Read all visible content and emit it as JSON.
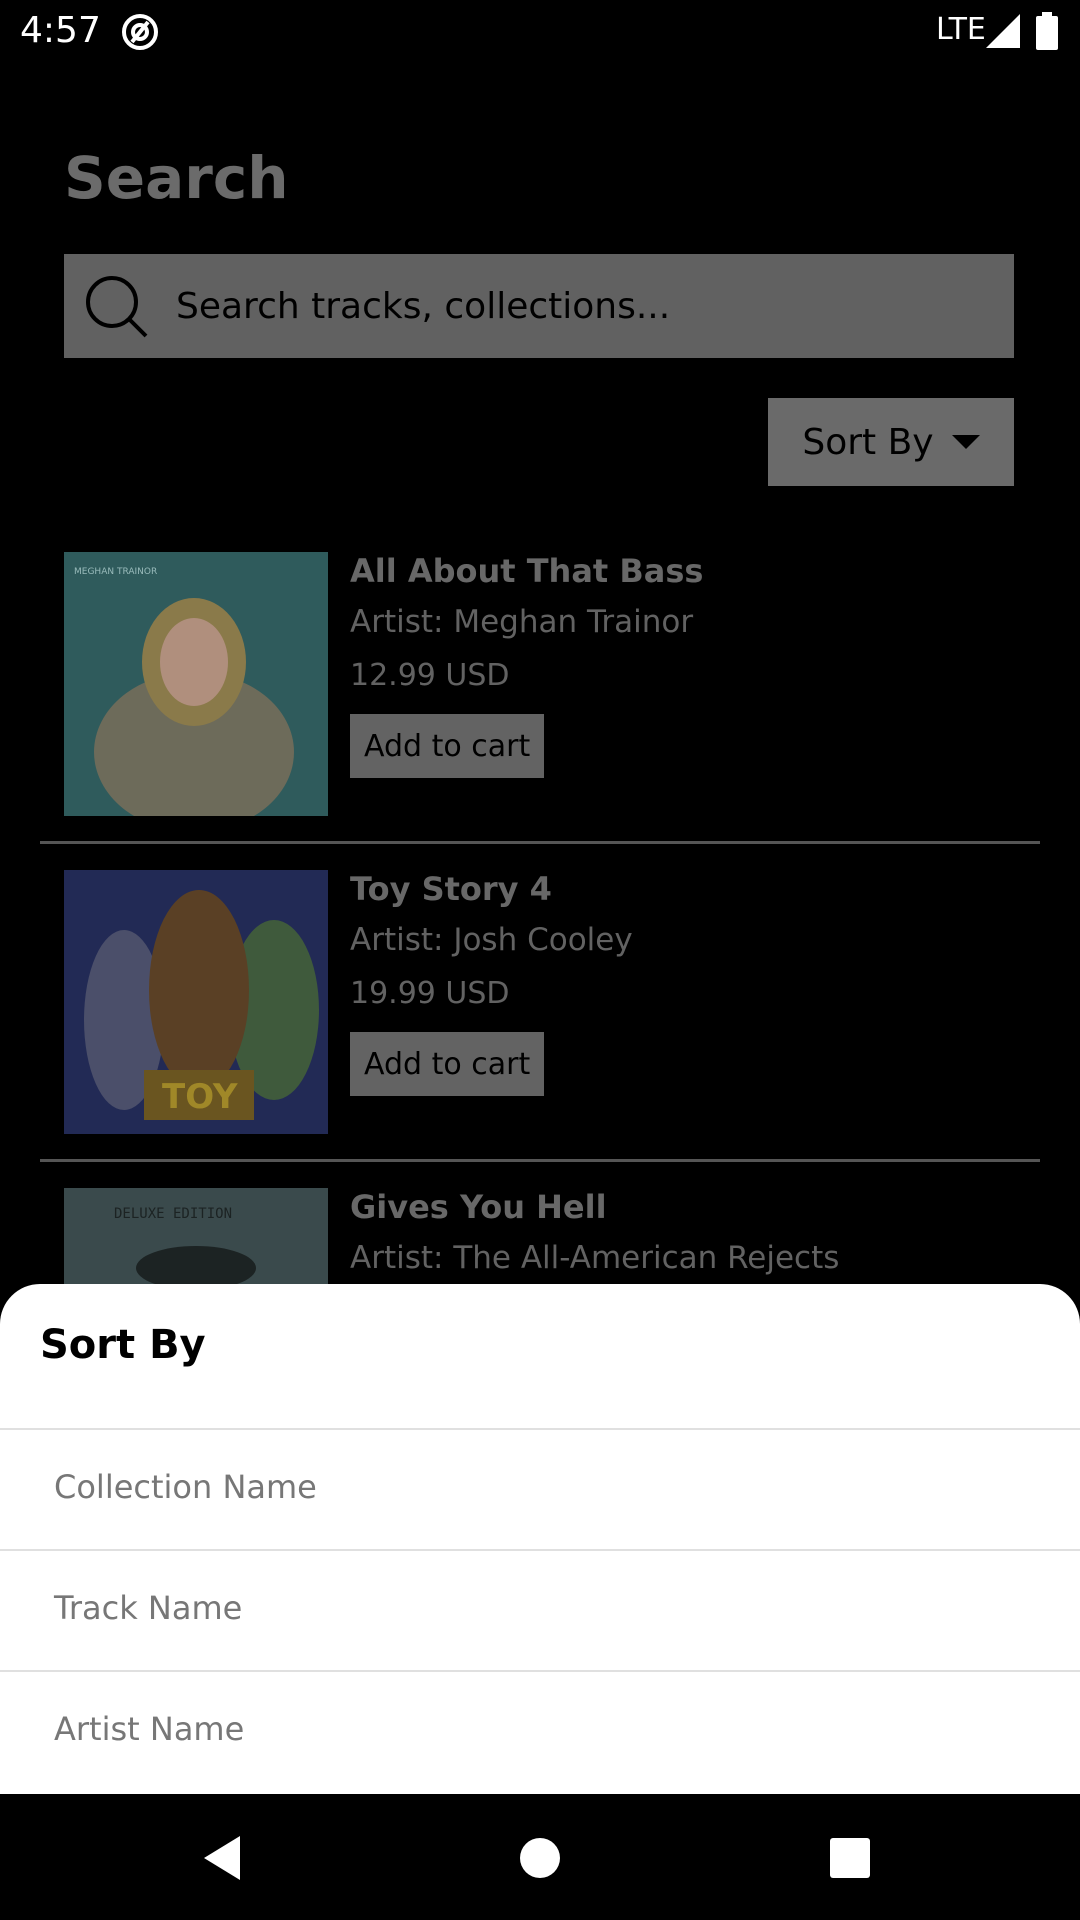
{
  "status_bar": {
    "time": "4:57",
    "network": "LTE"
  },
  "page": {
    "title": "Search",
    "search": {
      "placeholder": "Search tracks, collections..."
    },
    "sort_button_label": "Sort By",
    "results": [
      {
        "title": "All About That Bass",
        "artist": "Artist: Meghan Trainor",
        "price": "12.99 USD",
        "cart_label": "Add to cart",
        "art_text": "MEGHAN TRAINOR"
      },
      {
        "title": "Toy Story 4",
        "artist": "Artist: Josh Cooley",
        "price": "19.99 USD",
        "cart_label": "Add to cart",
        "art_text": "TOY"
      },
      {
        "title": "Gives You Hell",
        "artist": "Artist: The All-American Rejects",
        "art_text": "DELUXE EDITION"
      }
    ]
  },
  "sort_sheet": {
    "title": "Sort By",
    "options": [
      "Collection Name",
      "Track Name",
      "Artist Name"
    ]
  },
  "nav": {
    "icons": [
      "back-icon",
      "home-icon",
      "recents-icon"
    ]
  }
}
